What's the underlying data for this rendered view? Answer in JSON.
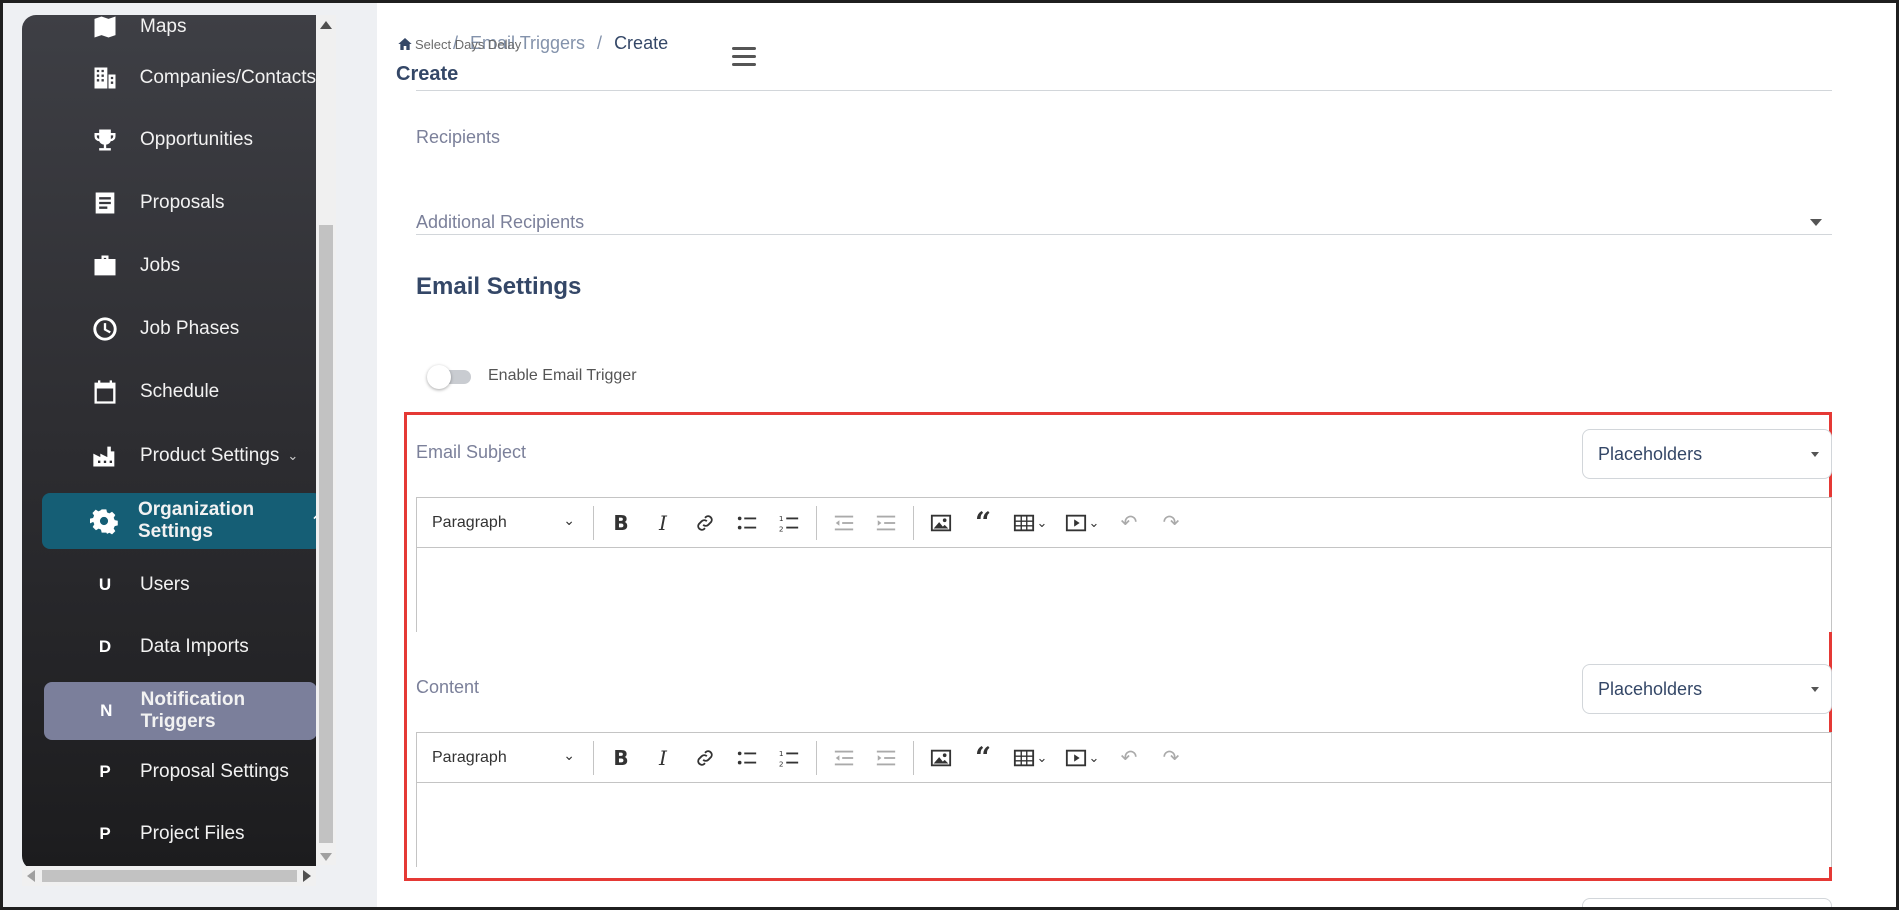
{
  "sidebar": {
    "items": [
      {
        "label": "Maps",
        "icon": "map-icon"
      },
      {
        "label": "Companies/Contacts",
        "icon": "building-icon"
      },
      {
        "label": "Opportunities",
        "icon": "trophy-icon"
      },
      {
        "label": "Proposals",
        "icon": "document-icon"
      },
      {
        "label": "Jobs",
        "icon": "briefcase-icon"
      },
      {
        "label": "Job Phases",
        "icon": "clock-icon"
      },
      {
        "label": "Schedule",
        "icon": "calendar-icon"
      },
      {
        "label": "Product Settings",
        "icon": "factory-icon"
      },
      {
        "label": "Organization Settings",
        "icon": "gear-icon"
      }
    ],
    "sub_items": [
      {
        "letter": "U",
        "label": "Users"
      },
      {
        "letter": "D",
        "label": "Data Imports"
      },
      {
        "letter": "N",
        "label": "Notification Triggers"
      },
      {
        "letter": "P",
        "label": "Proposal Settings"
      },
      {
        "letter": "P",
        "label": "Project Files"
      }
    ]
  },
  "header": {
    "breadcrumb_parent": "Email Triggers",
    "breadcrumb_separator": "/",
    "breadcrumb_current": "Create",
    "overlay_text": "Select Days Delay",
    "page_title": "Create"
  },
  "form": {
    "recipients_label": "Recipients",
    "additional_recipients_label": "Additional Recipients",
    "section_title": "Email Settings",
    "enable_trigger_label": "Enable Email Trigger",
    "email_subject_label": "Email Subject",
    "content_label": "Content",
    "placeholders_label": "Placeholders",
    "paragraph_label": "Paragraph"
  },
  "colors": {
    "active_parent": "#155e75",
    "active_child": "#7b7f9b",
    "highlight": "#e53935",
    "heading": "#344767"
  }
}
